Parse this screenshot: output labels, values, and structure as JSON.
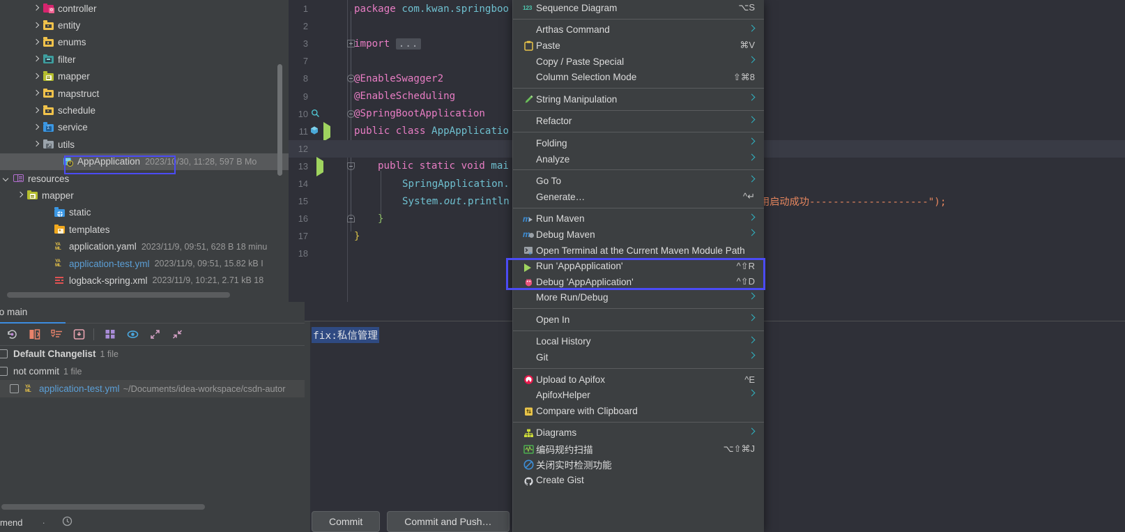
{
  "project_tree": {
    "items": [
      {
        "arrow": "right",
        "icon": "folder-controller",
        "label": "controller",
        "meta": ""
      },
      {
        "arrow": "right",
        "icon": "folder-entity",
        "label": "entity",
        "meta": ""
      },
      {
        "arrow": "right",
        "icon": "folder-enums",
        "label": "enums",
        "meta": ""
      },
      {
        "arrow": "right",
        "icon": "folder-filter",
        "label": "filter",
        "meta": ""
      },
      {
        "arrow": "right",
        "icon": "folder-mapper",
        "label": "mapper",
        "meta": ""
      },
      {
        "arrow": "right",
        "icon": "folder-mapstruct",
        "label": "mapstruct",
        "meta": ""
      },
      {
        "arrow": "right",
        "icon": "folder-schedule",
        "label": "schedule",
        "meta": ""
      },
      {
        "arrow": "right",
        "icon": "folder-service",
        "label": "service",
        "meta": ""
      },
      {
        "arrow": "right",
        "icon": "folder-utils",
        "label": "utils",
        "meta": ""
      },
      {
        "arrow": "none",
        "icon": "java-class-icon",
        "label": "AppApplication",
        "meta": "2023/10/30, 11:28, 597 B Mo"
      },
      {
        "arrow": "down",
        "icon": "resources-root-icon",
        "label": "resources",
        "meta": ""
      },
      {
        "arrow": "right",
        "icon": "folder-mapper",
        "label": "mapper",
        "meta": ""
      },
      {
        "arrow": "none",
        "icon": "folder-static",
        "label": "static",
        "meta": ""
      },
      {
        "arrow": "none",
        "icon": "folder-templates",
        "label": "templates",
        "meta": ""
      },
      {
        "arrow": "none",
        "icon": "yaml-file-icon",
        "label": "application.yaml",
        "meta": "2023/11/9, 09:51, 628 B 18 minu"
      },
      {
        "arrow": "none",
        "icon": "yaml-file-icon",
        "label": "application-test.yml",
        "meta": "2023/11/9, 09:51, 15.82 kB I"
      },
      {
        "arrow": "none",
        "icon": "xml-file-icon",
        "label": "logback-spring.xml",
        "meta": "2023/11/9, 10:21, 2.71 kB 18"
      }
    ]
  },
  "editor": {
    "lines": [
      {
        "num": "1",
        "indent": 0
      },
      {
        "num": "2",
        "indent": 0
      },
      {
        "num": "3",
        "indent": 0
      },
      {
        "num": "7",
        "indent": 0
      },
      {
        "num": "8",
        "indent": 0
      },
      {
        "num": "9",
        "indent": 0
      },
      {
        "num": "10",
        "indent": 0
      },
      {
        "num": "11",
        "indent": 0
      },
      {
        "num": "12",
        "indent": 0
      },
      {
        "num": "13",
        "indent": 0
      },
      {
        "num": "14",
        "indent": 0
      },
      {
        "num": "15",
        "indent": 0
      },
      {
        "num": "16",
        "indent": 0
      },
      {
        "num": "17",
        "indent": 0
      },
      {
        "num": "18",
        "indent": 0
      }
    ],
    "code": {
      "package_kw": "package",
      "package_name": "com.kwan.springboo",
      "import_kw": "import",
      "import_ellipsis": "...",
      "ann_swagger": "@EnableSwagger2",
      "ann_scheduling": "@EnableScheduling",
      "ann_springboot": "@SpringBootApplication",
      "class_decl_kw": "public class",
      "class_name": "AppApplicatio",
      "main_kw": "public static void",
      "main_name": "mai",
      "run_call": "SpringApplication.",
      "sysout_sys": "System.",
      "sysout_out": "out",
      "sysout_println": ".println",
      "close_brace_inner": "}",
      "close_brace_outer": "}",
      "console_string": "用启动成功--------------------\");"
    }
  },
  "commit_panel": {
    "tab_label": "mmit to main",
    "toolbar_icons": [
      "revert-icon",
      "show-diff-icon",
      "group-by-icon",
      "shelve-icon",
      "expand-grid-icon",
      "preview-eye-icon",
      "expand-all-icon",
      "collapse-all-icon"
    ],
    "changelists": [
      {
        "label": "Default Changelist",
        "count": "1 file",
        "bold": true
      },
      {
        "label": "not commit",
        "count": "1 file",
        "bold": false
      }
    ],
    "file": {
      "name": "application-test.yml",
      "path": "~/Documents/idea-workspace/csdn-autor"
    },
    "amend_label": "mend",
    "message": "fix:私信管理",
    "buttons": [
      {
        "label": "Commit"
      },
      {
        "label": "Commit and Push…"
      }
    ]
  },
  "context_menu": {
    "groups": [
      {
        "items": [
          {
            "label": "Sequence Diagram",
            "icon": "sequence-diagram-icon",
            "shortcut": "⌥S",
            "chevron": false
          }
        ]
      },
      {
        "items": [
          {
            "label": "Arthas Command",
            "icon": "",
            "shortcut": "",
            "chevron": true
          },
          {
            "label": "Paste",
            "icon": "paste-clipboard-icon",
            "shortcut": "⌘V",
            "chevron": false
          },
          {
            "label": "Copy / Paste Special",
            "icon": "",
            "shortcut": "",
            "chevron": true
          },
          {
            "label": "Column Selection Mode",
            "icon": "",
            "shortcut": "⇧⌘8",
            "chevron": false
          }
        ]
      },
      {
        "items": [
          {
            "label": "String Manipulation",
            "icon": "pencil-icon",
            "shortcut": "",
            "chevron": true
          }
        ]
      },
      {
        "items": [
          {
            "label": "Refactor",
            "icon": "",
            "shortcut": "",
            "chevron": true
          }
        ]
      },
      {
        "items": [
          {
            "label": "Folding",
            "icon": "",
            "shortcut": "",
            "chevron": true
          },
          {
            "label": "Analyze",
            "icon": "",
            "shortcut": "",
            "chevron": true
          }
        ]
      },
      {
        "items": [
          {
            "label": "Go To",
            "icon": "",
            "shortcut": "",
            "chevron": true
          },
          {
            "label": "Generate…",
            "icon": "",
            "shortcut": "^↵",
            "chevron": false
          }
        ]
      },
      {
        "items": [
          {
            "label": "Run Maven",
            "icon": "maven-run-icon",
            "shortcut": "",
            "chevron": true
          },
          {
            "label": "Debug Maven",
            "icon": "maven-debug-icon",
            "shortcut": "",
            "chevron": true
          },
          {
            "label": "Open Terminal at the Current Maven Module Path",
            "icon": "terminal-icon",
            "shortcut": "",
            "chevron": false
          },
          {
            "label": "Run 'AppApplication'",
            "icon": "run-play-icon",
            "shortcut": "^⇧R",
            "chevron": false
          },
          {
            "label": "Debug 'AppApplication'",
            "icon": "debug-bug-icon",
            "shortcut": "^⇧D",
            "chevron": false
          },
          {
            "label": "More Run/Debug",
            "icon": "",
            "shortcut": "",
            "chevron": true
          }
        ]
      },
      {
        "items": [
          {
            "label": "Open In",
            "icon": "",
            "shortcut": "",
            "chevron": true
          }
        ]
      },
      {
        "items": [
          {
            "label": "Local History",
            "icon": "",
            "shortcut": "",
            "chevron": true
          },
          {
            "label": "Git",
            "icon": "",
            "shortcut": "",
            "chevron": true
          }
        ]
      },
      {
        "items": [
          {
            "label": "Upload to Apifox",
            "icon": "apifox-icon",
            "shortcut": "^E",
            "chevron": false
          },
          {
            "label": "ApifoxHelper",
            "icon": "",
            "shortcut": "",
            "chevron": true
          },
          {
            "label": "Compare with Clipboard",
            "icon": "compare-clipboard-icon",
            "shortcut": "",
            "chevron": false
          }
        ]
      },
      {
        "items": [
          {
            "label": "Diagrams",
            "icon": "diagrams-icon",
            "shortcut": "",
            "chevron": true
          },
          {
            "label": "编码规约扫描",
            "icon": "code-scan-icon",
            "shortcut": "⌥⇧⌘J",
            "chevron": false
          },
          {
            "label": "关闭实时检测功能",
            "icon": "disable-inspection-icon",
            "shortcut": "",
            "chevron": false
          },
          {
            "label": "Create Gist",
            "icon": "gist-icon",
            "shortcut": "",
            "chevron": false
          }
        ]
      }
    ]
  },
  "colors": {
    "annotation_box": "#4b4bf5",
    "panel_bg": "#3c3f41",
    "editor_bg": "#2f3038",
    "selection_blue": "#2f4a82",
    "accent_blue": "#3c8ce0",
    "chevron_teal": "#2fb5c4"
  }
}
